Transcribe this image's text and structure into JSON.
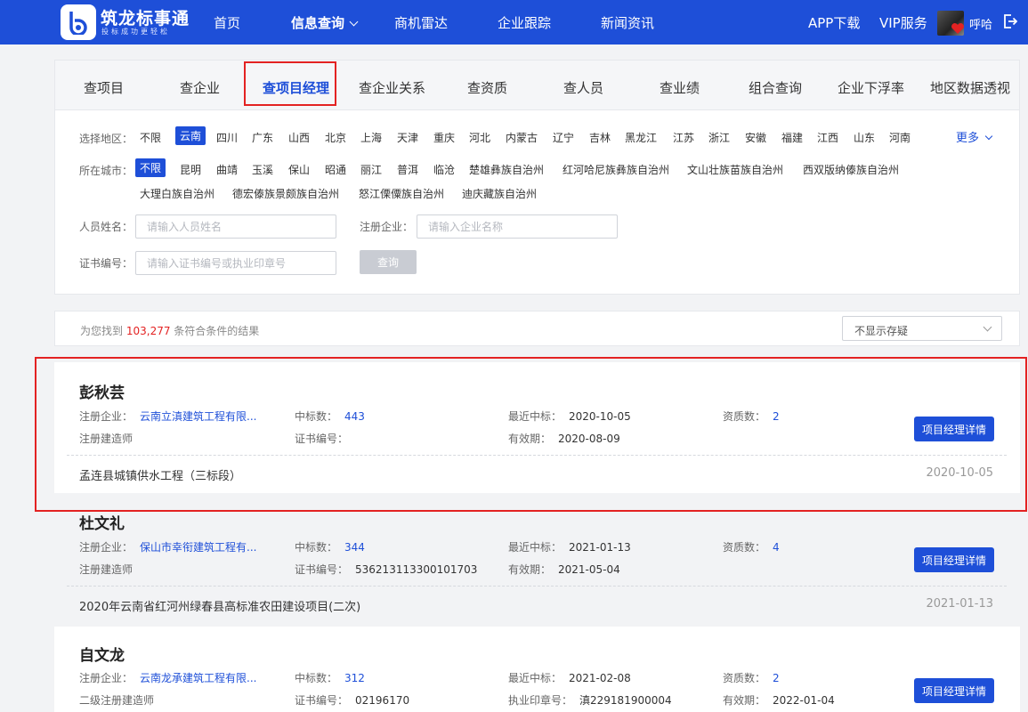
{
  "header": {
    "logo_title": "筑龙标事通",
    "logo_subtitle": "投标成功更轻松",
    "nav": [
      {
        "label": "首页"
      },
      {
        "label": "信息查询"
      },
      {
        "label": "商机雷达"
      },
      {
        "label": "企业跟踪"
      },
      {
        "label": "新闻资讯"
      }
    ],
    "app_download": "APP下载",
    "vip": "VIP服务",
    "username": "呼哈"
  },
  "tabs": [
    "查项目",
    "查企业",
    "查项目经理",
    "查企业关系",
    "查资质",
    "查人员",
    "查业绩",
    "组合查询",
    "企业下浮率",
    "地区数据透视"
  ],
  "filters": {
    "region_label": "选择地区：",
    "regions": [
      "不限",
      "云南",
      "四川",
      "广东",
      "山西",
      "北京",
      "上海",
      "天津",
      "重庆",
      "河北",
      "内蒙古",
      "辽宁",
      "吉林",
      "黑龙江",
      "江苏",
      "浙江",
      "安徽",
      "福建",
      "江西",
      "山东",
      "河南"
    ],
    "more": "更多",
    "city_label": "所在城市：",
    "cities": [
      "不限",
      "昆明",
      "曲靖",
      "玉溪",
      "保山",
      "昭通",
      "丽江",
      "普洱",
      "临沧",
      "楚雄彝族自治州",
      "红河哈尼族彝族自治州",
      "文山壮族苗族自治州",
      "西双版纳傣族自治州",
      "大理白族自治州",
      "德宏傣族景颇族自治州",
      "怒江傈僳族自治州",
      "迪庆藏族自治州"
    ],
    "name_label": "人员姓名：",
    "name_placeholder": "请输入人员姓名",
    "company_label": "注册企业：",
    "company_placeholder": "请输入企业名称",
    "cert_label": "证书编号：",
    "cert_placeholder": "请输入证书编号或执业印章号",
    "query_button": "查询"
  },
  "results": {
    "prefix": "为您找到",
    "count": "103,277",
    "suffix": "条符合条件的结果",
    "select_value": "不显示存疑"
  },
  "labels": {
    "company": "注册企业：",
    "wins": "中标数：",
    "recent": "最近中标：",
    "quals": "资质数：",
    "cert": "证书编号：",
    "valid": "有效期：",
    "seal": "执业印章号：",
    "detail_button": "项目经理详情"
  },
  "cards": [
    {
      "name": "彭秋芸",
      "company": "云南立滇建筑工程有限...",
      "wins": "443",
      "recent": "2020-10-05",
      "quals": "2",
      "role": "注册建造师",
      "cert": "",
      "valid": "2020-08-09",
      "project": "孟连县城镇供水工程（三标段）",
      "project_date": "2020-10-05"
    },
    {
      "name": "杜文礼",
      "company": "保山市幸衔建筑工程有...",
      "wins": "344",
      "recent": "2021-01-13",
      "quals": "4",
      "role": "注册建造师",
      "cert": "536213113300101703",
      "valid": "2021-05-04",
      "project": "2020年云南省红河州绿春县高标准农田建设项目(二次)",
      "project_date": "2021-01-13"
    },
    {
      "name": "自文龙",
      "company": "云南龙承建筑工程有限...",
      "wins": "312",
      "recent": "2021-02-08",
      "quals": "2",
      "role": "二级注册建造师",
      "cert": "02196170",
      "seal": "滇229181900004",
      "valid": "2022-01-04"
    }
  ]
}
